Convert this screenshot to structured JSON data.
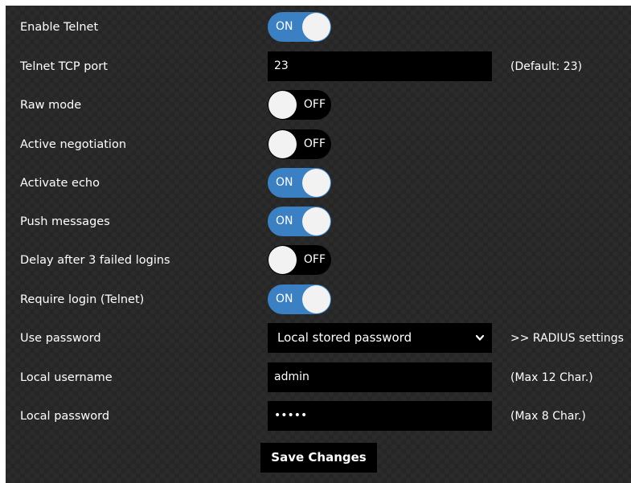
{
  "settings": {
    "enable_telnet": {
      "label": "Enable Telnet",
      "state": "ON"
    },
    "telnet_port": {
      "label": "Telnet TCP port",
      "value": "23",
      "hint": "(Default: 23)"
    },
    "raw_mode": {
      "label": "Raw mode",
      "state": "OFF"
    },
    "active_negotiation": {
      "label": "Active negotiation",
      "state": "OFF"
    },
    "activate_echo": {
      "label": "Activate echo",
      "state": "ON"
    },
    "push_messages": {
      "label": "Push messages",
      "state": "ON"
    },
    "delay_failed_logins": {
      "label": "Delay after 3 failed logins",
      "state": "OFF"
    },
    "require_login": {
      "label": "Require login (Telnet)",
      "state": "ON"
    },
    "use_password": {
      "label": "Use password",
      "selected": "Local stored password",
      "link": ">> RADIUS settings"
    },
    "local_username": {
      "label": "Local username",
      "value": "admin",
      "hint": "(Max 12 Char.)"
    },
    "local_password": {
      "label": "Local password",
      "value": "•••••",
      "hint": "(Max 8 Char.)"
    }
  },
  "actions": {
    "save_label": "Save Changes"
  },
  "colors": {
    "toggle_on": "#3a80c2",
    "toggle_off": "#000000",
    "panel_bg": "#262626"
  }
}
